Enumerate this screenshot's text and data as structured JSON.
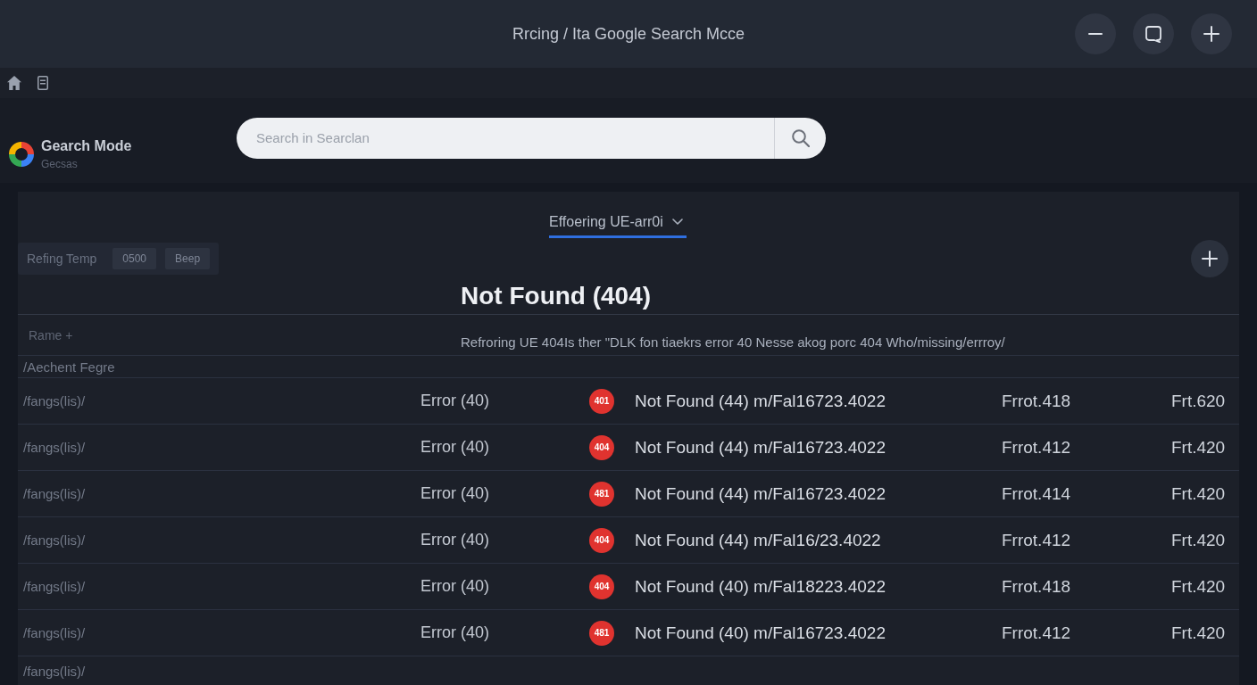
{
  "window": {
    "title": "Rrcing / Ita Google Search Mcce"
  },
  "sidebar": {
    "app_name": "Gearch Mode",
    "subtitle": "Gecsas"
  },
  "search": {
    "placeholder": "Search in Searclan"
  },
  "tabs": [
    {
      "label": "Effoering UE-arr0i",
      "selected": true
    }
  ],
  "filter": {
    "label": "Refing Temp",
    "chips": [
      "0500",
      "Beep"
    ]
  },
  "heading": "Not Found (404)",
  "description": "Refroring UE 404Is ther \"DLK fon tiaekrs error 40 Nesse akog porc 404 Who/missing/errroy/",
  "table": {
    "column_1_header": "Rame +",
    "group_label": "/Aechent Fegre",
    "rows": [
      {
        "path": "/fangs(lis)/",
        "error": "Error (40)",
        "badge": "401",
        "message": "Not Found (44) m/Fal16723.4022",
        "column_5": "Frrot.418",
        "column_6": "Frt.620"
      },
      {
        "path": "/fangs(lis)/",
        "error": "Error (40)",
        "badge": "404",
        "message": "Not Found (44) m/Fal16723.4022",
        "column_5": "Frrot.412",
        "column_6": "Frt.420"
      },
      {
        "path": "/fangs(lis)/",
        "error": "Error (40)",
        "badge": "481",
        "message": "Not Found (44) m/Fal16723.4022",
        "column_5": "Frrot.414",
        "column_6": "Frt.420"
      },
      {
        "path": "/fangs(lis)/",
        "error": "Error (40)",
        "badge": "404",
        "message": "Not Found (44) m/Fal16/23.4022",
        "column_5": "Frrot.412",
        "column_6": "Frt.420"
      },
      {
        "path": "/fangs(lis)/",
        "error": "Error (40)",
        "badge": "404",
        "message": "Not Found (40) m/Fal18223.4022",
        "column_5": "Frrot.418",
        "column_6": "Frt.420"
      },
      {
        "path": "/fangs(lis)/",
        "error": "Error (40)",
        "badge": "481",
        "message": "Not Found (40) m/Fal16723.4022",
        "column_5": "Frrot.412",
        "column_6": "Frt.420"
      },
      {
        "path": "/fangs(lis)/"
      }
    ]
  }
}
